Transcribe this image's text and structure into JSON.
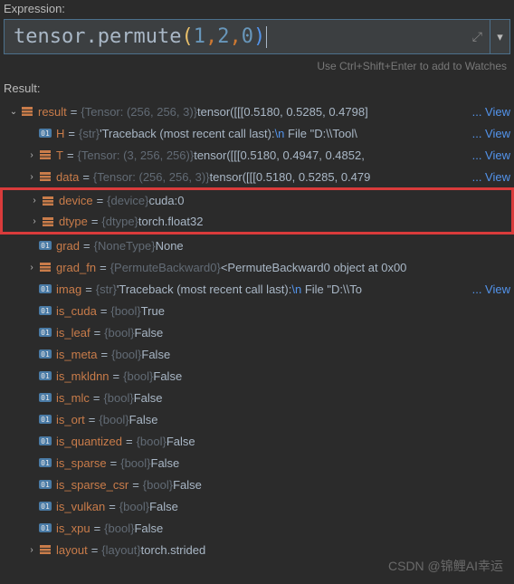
{
  "labels": {
    "expression": "Expression:",
    "result": "Result:",
    "hint": "Use Ctrl+Shift+Enter to add to Watches",
    "view": "... View"
  },
  "expression": {
    "tokens": [
      "tensor",
      ".",
      "permute",
      "(",
      "1",
      ", ",
      "2",
      ", ",
      "0",
      ")"
    ]
  },
  "tree": [
    {
      "depth": 0,
      "arrow": "down",
      "icon": "obj",
      "name": "result",
      "type": "{Tensor: (256, 256, 3)}",
      "val": "tensor([[[0.5180, 0.5285, 0.4798]",
      "view": true
    },
    {
      "depth": 1,
      "arrow": "",
      "icon": "prim",
      "name": "H",
      "type": "{str}",
      "val": "'Traceback (most recent call last):\\n  File \"D:\\\\Tool\\",
      "valClass": "val",
      "view": true
    },
    {
      "depth": 1,
      "arrow": "right",
      "icon": "obj",
      "name": "T",
      "type": "{Tensor: (3, 256, 256)}",
      "val": "tensor([[[0.5180, 0.4947, 0.4852, ",
      "view": true
    },
    {
      "depth": 1,
      "arrow": "right",
      "icon": "obj",
      "name": "data",
      "type": "{Tensor: (256, 256, 3)}",
      "val": "tensor([[[0.5180, 0.5285, 0.479",
      "view": true
    },
    {
      "depth": 1,
      "arrow": "right",
      "icon": "obj",
      "name": "device",
      "type": "{device}",
      "val": "cuda:0",
      "hl": "top"
    },
    {
      "depth": 1,
      "arrow": "right",
      "icon": "obj",
      "name": "dtype",
      "type": "{dtype}",
      "val": "torch.float32",
      "hl": "bottom"
    },
    {
      "depth": 1,
      "arrow": "",
      "icon": "prim",
      "name": "grad",
      "type": "{NoneType}",
      "val": "None"
    },
    {
      "depth": 1,
      "arrow": "right",
      "icon": "obj",
      "name": "grad_fn",
      "type": "{PermuteBackward0}",
      "val": "<PermuteBackward0 object at 0x00"
    },
    {
      "depth": 1,
      "arrow": "",
      "icon": "prim",
      "name": "imag",
      "type": "{str}",
      "val": "'Traceback (most recent call last):\\n  File \"D:\\\\To",
      "view": true
    },
    {
      "depth": 1,
      "arrow": "",
      "icon": "prim",
      "name": "is_cuda",
      "type": "{bool}",
      "val": "True"
    },
    {
      "depth": 1,
      "arrow": "",
      "icon": "prim",
      "name": "is_leaf",
      "type": "{bool}",
      "val": "False"
    },
    {
      "depth": 1,
      "arrow": "",
      "icon": "prim",
      "name": "is_meta",
      "type": "{bool}",
      "val": "False"
    },
    {
      "depth": 1,
      "arrow": "",
      "icon": "prim",
      "name": "is_mkldnn",
      "type": "{bool}",
      "val": "False"
    },
    {
      "depth": 1,
      "arrow": "",
      "icon": "prim",
      "name": "is_mlc",
      "type": "{bool}",
      "val": "False"
    },
    {
      "depth": 1,
      "arrow": "",
      "icon": "prim",
      "name": "is_ort",
      "type": "{bool}",
      "val": "False"
    },
    {
      "depth": 1,
      "arrow": "",
      "icon": "prim",
      "name": "is_quantized",
      "type": "{bool}",
      "val": "False"
    },
    {
      "depth": 1,
      "arrow": "",
      "icon": "prim",
      "name": "is_sparse",
      "type": "{bool}",
      "val": "False"
    },
    {
      "depth": 1,
      "arrow": "",
      "icon": "prim",
      "name": "is_sparse_csr",
      "type": "{bool}",
      "val": "False"
    },
    {
      "depth": 1,
      "arrow": "",
      "icon": "prim",
      "name": "is_vulkan",
      "type": "{bool}",
      "val": "False"
    },
    {
      "depth": 1,
      "arrow": "",
      "icon": "prim",
      "name": "is_xpu",
      "type": "{bool}",
      "val": "False"
    },
    {
      "depth": 1,
      "arrow": "right",
      "icon": "obj",
      "name": "layout",
      "type": "{layout}",
      "val": "torch.strided"
    }
  ],
  "watermark": "CSDN @锦鲤AI幸运"
}
